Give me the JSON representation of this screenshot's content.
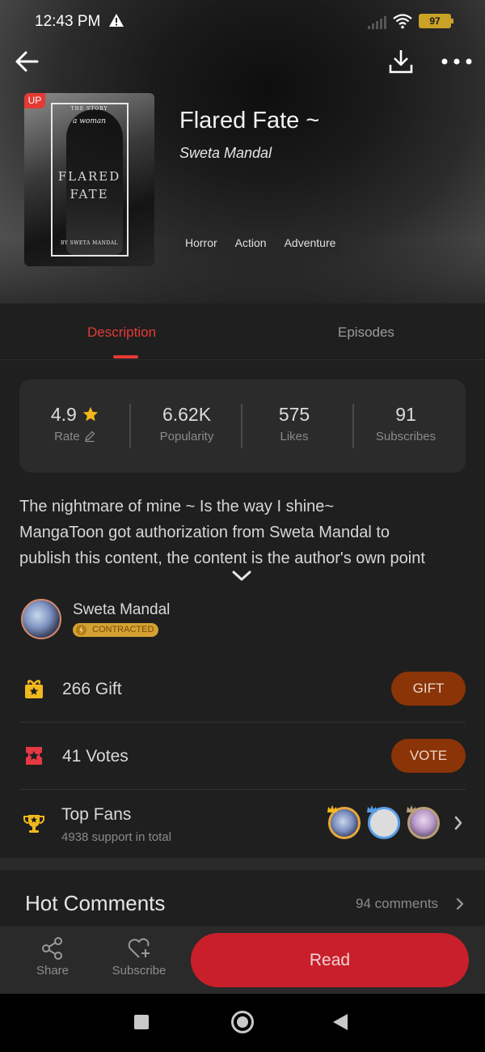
{
  "status_bar": {
    "time": "12:43 PM",
    "battery": "97"
  },
  "comic": {
    "title": "Flared Fate ~",
    "author": "Sweta Mandal",
    "badge": "UP",
    "tags": [
      "Horror",
      "Action",
      "Adventure"
    ],
    "cover": {
      "story": "THE STORY",
      "woman": "a woman",
      "title_line1": "FLARED",
      "title_line2": "FATE",
      "author": "BY SWETA MANDAL"
    }
  },
  "tabs": [
    {
      "label": "Description",
      "active": true
    },
    {
      "label": "Episodes",
      "active": false
    }
  ],
  "stats": [
    {
      "value": "4.9",
      "label": "Rate"
    },
    {
      "value": "6.62K",
      "label": "Popularity"
    },
    {
      "value": "575",
      "label": "Likes"
    },
    {
      "value": "91",
      "label": "Subscribes"
    }
  ],
  "description": {
    "line1": "The nightmare of mine ~ Is the way I shine~",
    "line2": "MangaToon got authorization from Sweta Mandal to",
    "line3": "publish this content, the content is the author's own point"
  },
  "author_block": {
    "name": "Sweta Mandal",
    "badge": "CONTRACTED"
  },
  "gift": {
    "count": "266",
    "label": "Gift",
    "button": "GIFT"
  },
  "vote": {
    "count": "41",
    "label": "Votes",
    "button": "VOTE"
  },
  "top_fans": {
    "title": "Top Fans",
    "subtitle": "4938 support in total"
  },
  "hot_comments": {
    "title": "Hot Comments",
    "count": "94 comments"
  },
  "bottom_bar": {
    "share": "Share",
    "subscribe": "Subscribe",
    "read": "Read"
  },
  "colors": {
    "accent_red": "#e53935",
    "pill_brown": "#8a3408",
    "read_red": "#c81f2a",
    "gold": "#d4a232"
  }
}
